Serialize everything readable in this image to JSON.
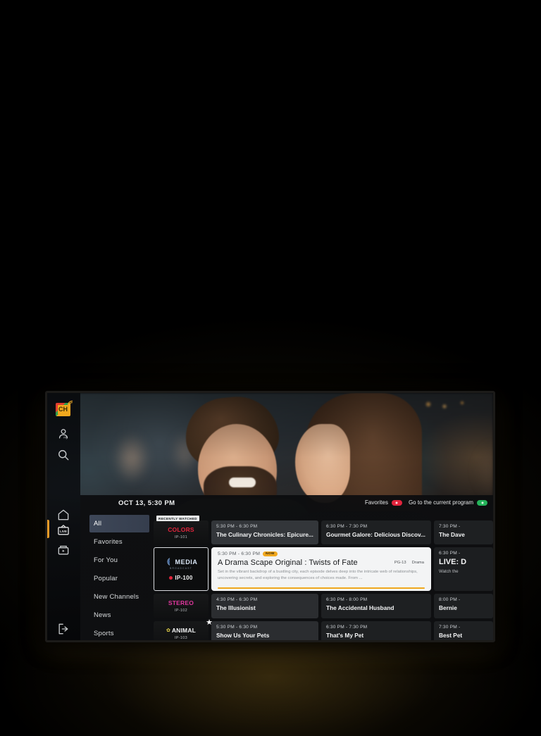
{
  "app": {
    "logo_text": "CH",
    "logo_name": "channels-logo"
  },
  "rail": {
    "top_items": [
      {
        "name": "profile-icon",
        "label": "My Profile"
      },
      {
        "name": "search-icon",
        "label": "Search"
      }
    ],
    "nav_items": [
      {
        "name": "home-icon",
        "label": "Home",
        "active": false
      },
      {
        "name": "live-tv-icon",
        "label": "LIVE",
        "active": true
      },
      {
        "name": "recordings-icon",
        "label": "Recordings",
        "active": false
      }
    ],
    "bottom_items": [
      {
        "name": "exit-icon",
        "label": "Exit"
      }
    ],
    "active_color": "#e79a27"
  },
  "guide": {
    "date_label": "OCT 13, 5:30 PM",
    "actions": [
      {
        "label": "Favorites",
        "pill": "red",
        "pill_color": "#e1243c"
      },
      {
        "label": "Go to the current program",
        "pill": "green",
        "pill_color": "#24b35a"
      }
    ],
    "categories": [
      {
        "label": "All",
        "active": true
      },
      {
        "label": "Favorites",
        "active": false
      },
      {
        "label": "For You",
        "active": false
      },
      {
        "label": "Popular",
        "active": false
      },
      {
        "label": "New Channels",
        "active": false
      },
      {
        "label": "News",
        "active": false
      },
      {
        "label": "Sports",
        "active": false
      }
    ],
    "rows": [
      {
        "channel": {
          "logo": "COLORS",
          "logo_color": "#e1243c",
          "number": "IP-101",
          "badge": "RECENTLY WATCHED",
          "favorite": false,
          "focused": false,
          "live": false
        },
        "programs": [
          {
            "time": "5:30 PM - 6:30 PM",
            "title": "The Culinary Chronicles: Epicure...",
            "style": "time-head"
          },
          {
            "time": "6:30 PM - 7:30 PM",
            "title": "Gourmet Galore: Delicious Discov...",
            "style": "dark"
          },
          {
            "time": "7:30 PM - ",
            "title": "The Dave",
            "style": "dark"
          }
        ]
      },
      {
        "channel": {
          "logo": "MEDIA",
          "logo_sub": "BROADCAST",
          "logo_color": "#2f6fd0",
          "number": "IP-100",
          "badge": "",
          "favorite": false,
          "focused": true,
          "live": true
        },
        "programs": [
          {
            "time": "5:30 PM - 6:30 PM",
            "tag": "NOW",
            "title": "A Drama Scape Original : Twists of Fate",
            "desc": "Set in the vibrant backdrop of a bustling city, each episode delves deep into the intricate web of relationships, uncovering secrets, and exploring the consequences of choices made. From ...",
            "rating": "PG-13",
            "genre": "Drama",
            "style": "selected"
          },
          {
            "time": "6:30 PM - ",
            "title": "LIVE: D",
            "sub": "Watch the",
            "style": "live-card"
          }
        ]
      },
      {
        "channel": {
          "logo": "STEREO",
          "logo_color": "#e0379e",
          "number": "IP-102",
          "badge": "",
          "favorite": false,
          "focused": false,
          "live": false
        },
        "programs": [
          {
            "time": "4:30 PM - 6:30 PM",
            "title": "The Illusionist",
            "style": "normal"
          },
          {
            "time": "6:30 PM - 8:00 PM",
            "title": "The Accidental Husband",
            "style": "dark"
          },
          {
            "time": "8:00 PM - ",
            "title": "Bernie",
            "style": "dark"
          }
        ]
      },
      {
        "channel": {
          "logo": "ANIMAL",
          "logo_color": "#f2f3f4",
          "number": "IP-103",
          "badge": "",
          "favorite": true,
          "focused": false,
          "live": false
        },
        "programs": [
          {
            "time": "5:30 PM - 6:30 PM",
            "title": "Show Us Your Pets",
            "style": "normal"
          },
          {
            "time": "6:30 PM - 7:30 PM",
            "title": "That's My Pet",
            "style": "dark"
          },
          {
            "time": "7:30 PM - ",
            "title": "Best Pet",
            "style": "dark"
          }
        ]
      }
    ]
  }
}
